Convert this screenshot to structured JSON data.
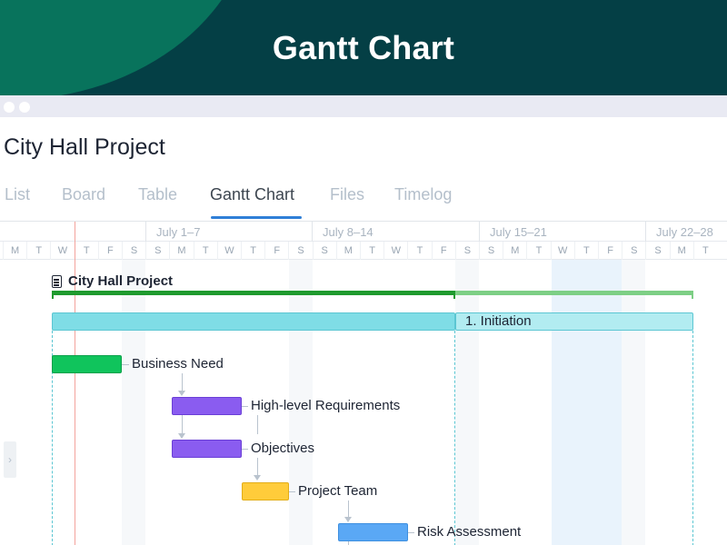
{
  "hero": {
    "title": "Gantt Chart"
  },
  "project": {
    "title": "City Hall Project"
  },
  "tabs": [
    {
      "label": "List",
      "active": false
    },
    {
      "label": "Board",
      "active": false
    },
    {
      "label": "Table",
      "active": false
    },
    {
      "label": "Gantt Chart",
      "active": true
    },
    {
      "label": "Files",
      "active": false
    },
    {
      "label": "Timelog",
      "active": false
    }
  ],
  "timeline": {
    "weeks": [
      "July 1–7",
      "July 8–14",
      "July 15–21",
      "July 22–28"
    ],
    "days": [
      "M",
      "T",
      "W",
      "T",
      "F",
      "S",
      "S",
      "M",
      "T",
      "W",
      "T",
      "F",
      "S",
      "S",
      "M",
      "T",
      "W",
      "T",
      "F",
      "S",
      "S",
      "M",
      "T",
      "W",
      "T",
      "F",
      "S",
      "S",
      "M",
      "T"
    ]
  },
  "gantt": {
    "project_row": {
      "label": "City Hall Project",
      "icon": "clipboard-icon"
    },
    "phase": {
      "label": "1. Initiation"
    },
    "tasks": [
      {
        "label": "Business Need",
        "color": "#10c45c"
      },
      {
        "label": "High-level Requirements",
        "color": "#8a5cf0"
      },
      {
        "label": "Objectives",
        "color": "#8a5cf0"
      },
      {
        "label": "Project Team",
        "color": "#ffcc3a"
      },
      {
        "label": "Risk Assessment",
        "color": "#5aa8f5"
      }
    ]
  },
  "colors": {
    "header_bg": "#043f45",
    "header_accent": "#08735c",
    "tab_active_underline": "#2f7fd7",
    "summary_done": "#1f9a2e",
    "summary_remaining": "#7dcf85",
    "phase_bar": "#7fdde6",
    "today_line": "#f3a39c"
  }
}
